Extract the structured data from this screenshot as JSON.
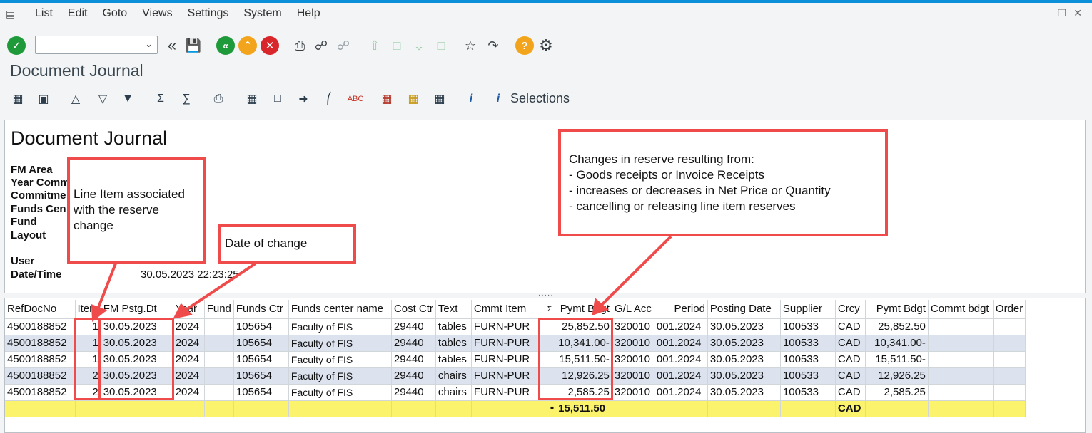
{
  "menu": [
    "List",
    "Edit",
    "Goto",
    "Views",
    "Settings",
    "System",
    "Help"
  ],
  "toolbar": {
    "command_value": ""
  },
  "page_title": "Document Journal",
  "app_toolbar": {
    "selections_label": "Selections"
  },
  "header": {
    "title": "Document Journal",
    "labels": {
      "fm_area": "FM Area",
      "year": "Year Comm",
      "commitment": "Commitme",
      "funds_center": "Funds Cen",
      "fund": "Fund",
      "layout": "Layout",
      "user": "User",
      "datetime": "Date/Time"
    },
    "datetime_value": "30.05.2023 22:23:25"
  },
  "columns": [
    "RefDocNo",
    "Item",
    "FM Pstg.Dt",
    "Year",
    "Fund",
    "Funds Ctr",
    "Funds center name",
    "Cost Ctr",
    "Text",
    "Cmmt Item",
    "Pymt Bdgt",
    "G/L Acc",
    "Period",
    "Posting Date",
    "Supplier",
    "Crcy",
    "Pymt Bdgt",
    "Commt bdgt",
    "Order"
  ],
  "sum_marker": "Σ",
  "rows": [
    {
      "refdoc": "4500188852",
      "item": "1",
      "fmdate": "30.05.2023",
      "year": "2024",
      "fund": "",
      "fctr": "105654",
      "fname": "Faculty of FIS",
      "cctr": "29440",
      "text": "tables",
      "cmmt": "FURN-PUR",
      "pymt": "25,852.50",
      "gl": "320010",
      "period": "001.2024",
      "pdate": "30.05.2023",
      "supplier": "100533",
      "crcy": "CAD",
      "pymt2": "25,852.50",
      "commt": "",
      "order": ""
    },
    {
      "refdoc": "4500188852",
      "item": "1",
      "fmdate": "30.05.2023",
      "year": "2024",
      "fund": "",
      "fctr": "105654",
      "fname": "Faculty of FIS",
      "cctr": "29440",
      "text": "tables",
      "cmmt": "FURN-PUR",
      "pymt": "10,341.00-",
      "gl": "320010",
      "period": "001.2024",
      "pdate": "30.05.2023",
      "supplier": "100533",
      "crcy": "CAD",
      "pymt2": "10,341.00-",
      "commt": "",
      "order": ""
    },
    {
      "refdoc": "4500188852",
      "item": "1",
      "fmdate": "30.05.2023",
      "year": "2024",
      "fund": "",
      "fctr": "105654",
      "fname": "Faculty of FIS",
      "cctr": "29440",
      "text": "tables",
      "cmmt": "FURN-PUR",
      "pymt": "15,511.50-",
      "gl": "320010",
      "period": "001.2024",
      "pdate": "30.05.2023",
      "supplier": "100533",
      "crcy": "CAD",
      "pymt2": "15,511.50-",
      "commt": "",
      "order": ""
    },
    {
      "refdoc": "4500188852",
      "item": "2",
      "fmdate": "30.05.2023",
      "year": "2024",
      "fund": "",
      "fctr": "105654",
      "fname": "Faculty of FIS",
      "cctr": "29440",
      "text": "chairs",
      "cmmt": "FURN-PUR",
      "pymt": "12,926.25",
      "gl": "320010",
      "period": "001.2024",
      "pdate": "30.05.2023",
      "supplier": "100533",
      "crcy": "CAD",
      "pymt2": "12,926.25",
      "commt": "",
      "order": ""
    },
    {
      "refdoc": "4500188852",
      "item": "2",
      "fmdate": "30.05.2023",
      "year": "2024",
      "fund": "",
      "fctr": "105654",
      "fname": "Faculty of FIS",
      "cctr": "29440",
      "text": "chairs",
      "cmmt": "FURN-PUR",
      "pymt": "2,585.25",
      "gl": "320010",
      "period": "001.2024",
      "pdate": "30.05.2023",
      "supplier": "100533",
      "crcy": "CAD",
      "pymt2": "2,585.25",
      "commt": "",
      "order": ""
    }
  ],
  "total": {
    "marker": "•",
    "amount": "15,511.50",
    "crcy": "CAD"
  },
  "annotations": {
    "line_item": "Line Item associated with the reserve change",
    "date_change": "Date of change",
    "reserve_title": "Changes in reserve resulting from:",
    "reserve_items": [
      "- Goods receipts or Invoice Receipts",
      "- increases or decreases in Net Price or Quantity",
      "- cancelling or releasing line item reserves"
    ]
  },
  "colors": {
    "accent": "#0a8fd8",
    "annotation_red": "#ef4b4b",
    "total_yellow": "#fbf36b",
    "row_alt": "#dce3ef"
  }
}
